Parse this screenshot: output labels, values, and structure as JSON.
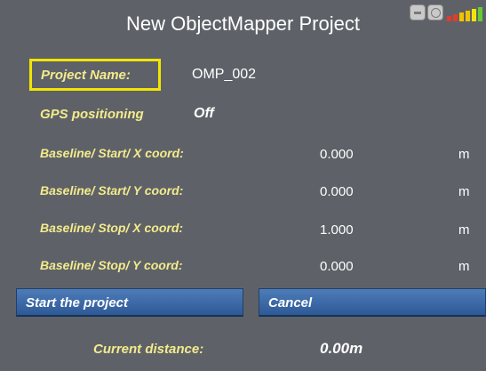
{
  "window": {
    "title": "New ObjectMapper Project",
    "icons": [
      "minimize-icon",
      "globe-icon",
      "signal-strength-icon"
    ],
    "signal_colors": [
      "#e23b2a",
      "#e23b2a",
      "#f2c200",
      "#f2c200",
      "#f2e500",
      "#66cc33"
    ]
  },
  "form": {
    "project_name": {
      "label": "Project Name:",
      "value": "OMP_002"
    },
    "gps": {
      "label": "GPS positioning",
      "value": "Off"
    },
    "start_x": {
      "label": "Baseline/ Start/ X coord:",
      "value": "0.000",
      "unit": "m"
    },
    "start_y": {
      "label": "Baseline/ Start/ Y coord:",
      "value": "0.000",
      "unit": "m"
    },
    "stop_x": {
      "label": "Baseline/ Stop/ X coord:",
      "value": "1.000",
      "unit": "m"
    },
    "stop_y": {
      "label": "Baseline/ Stop/ Y coord:",
      "value": "0.000",
      "unit": "m"
    }
  },
  "buttons": {
    "start": "Start the project",
    "cancel": "Cancel"
  },
  "footer": {
    "distance_label": "Current distance:",
    "distance_value": "0.00m"
  },
  "colors": {
    "background": "#5e6268",
    "label": "#f4eb8c",
    "highlight_border": "#f2e500",
    "button": "#3a68a6"
  }
}
